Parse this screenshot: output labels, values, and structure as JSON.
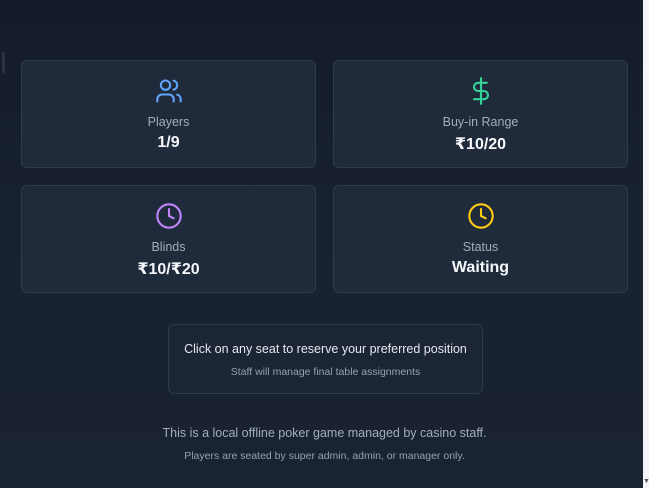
{
  "stats": [
    {
      "label": "Players",
      "value": "1/9",
      "icon": "users-icon",
      "color": "#60a5fa"
    },
    {
      "label": "Buy-in Range",
      "value": "₹10/20",
      "icon": "dollar-icon",
      "color": "#34d399"
    },
    {
      "label": "Blinds",
      "value": "₹10/₹20",
      "icon": "clock-icon",
      "color": "#c084fc"
    },
    {
      "label": "Status",
      "value": "Waiting",
      "icon": "clock-icon",
      "color": "#facc15"
    }
  ],
  "notice": {
    "main": "Click on any seat to reserve your preferred position",
    "sub": "Staff will manage final table assignments"
  },
  "footer": {
    "main": "This is a local offline poker game managed by casino staff.",
    "sub": "Players are seated by super admin, admin, or manager only."
  }
}
